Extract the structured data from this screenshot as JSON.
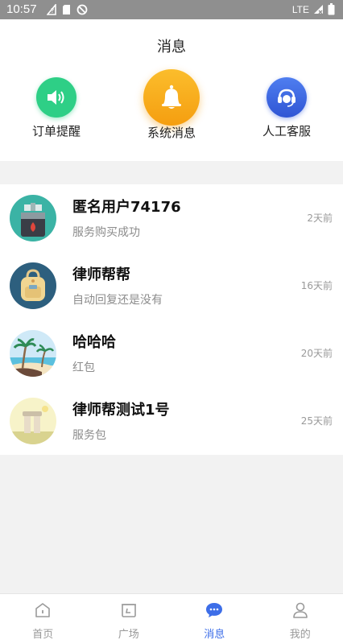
{
  "status_bar": {
    "time": "10:57",
    "network": "LTE"
  },
  "header": {
    "title": "消息"
  },
  "categories": [
    {
      "label": "订单提醒",
      "icon": "speaker-icon",
      "color": "#2ecf86"
    },
    {
      "label": "系统消息",
      "icon": "bell-icon",
      "color": "#f9a825"
    },
    {
      "label": "人工客服",
      "icon": "headset-icon",
      "color": "#3b63e0"
    }
  ],
  "messages": [
    {
      "name": "匿名用户74176",
      "preview": "服务购买成功",
      "time": "2天前"
    },
    {
      "name": "律师帮帮",
      "preview": "自动回复还是没有",
      "time": "16天前"
    },
    {
      "name": "哈哈哈",
      "preview": "红包",
      "time": "20天前"
    },
    {
      "name": "律师帮测试1号",
      "preview": "服务包",
      "time": "25天前"
    }
  ],
  "tabs": [
    {
      "label": "首页",
      "icon": "home-icon"
    },
    {
      "label": "广场",
      "icon": "square-icon"
    },
    {
      "label": "消息",
      "icon": "message-icon",
      "active": true
    },
    {
      "label": "我的",
      "icon": "profile-icon"
    }
  ],
  "colors": {
    "accent": "#3d6ee8",
    "inactive": "#999999"
  }
}
